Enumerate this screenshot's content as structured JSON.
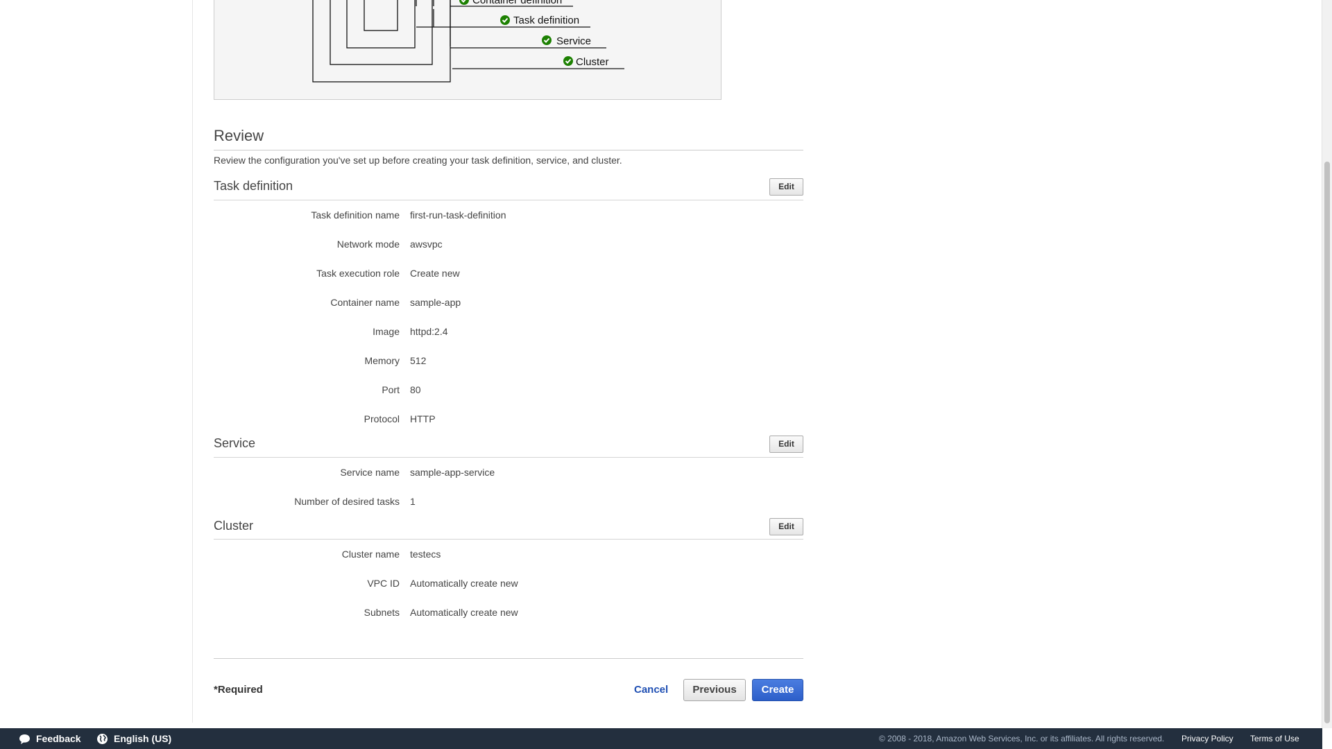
{
  "diagram": {
    "labels": [
      "Container definition",
      "Task definition",
      "Service",
      "Cluster"
    ],
    "check_color": "#1d8102"
  },
  "review": {
    "title": "Review",
    "description": "Review the configuration you've set up before creating your task definition, service, and cluster."
  },
  "sections": {
    "task_definition": {
      "title": "Task definition",
      "edit_label": "Edit",
      "rows": [
        {
          "label": "Task definition name",
          "value": "first-run-task-definition"
        },
        {
          "label": "Network mode",
          "value": "awsvpc"
        },
        {
          "label": "Task execution role",
          "value": "Create new"
        },
        {
          "label": "Container name",
          "value": "sample-app"
        },
        {
          "label": "Image",
          "value": "httpd:2.4"
        },
        {
          "label": "Memory",
          "value": "512"
        },
        {
          "label": "Port",
          "value": "80"
        },
        {
          "label": "Protocol",
          "value": "HTTP"
        }
      ]
    },
    "service": {
      "title": "Service",
      "edit_label": "Edit",
      "rows": [
        {
          "label": "Service name",
          "value": "sample-app-service"
        },
        {
          "label": "Number of desired tasks",
          "value": "1"
        }
      ]
    },
    "cluster": {
      "title": "Cluster",
      "edit_label": "Edit",
      "rows": [
        {
          "label": "Cluster name",
          "value": "testecs"
        },
        {
          "label": "VPC ID",
          "value": "Automatically create new"
        },
        {
          "label": "Subnets",
          "value": "Automatically create new"
        }
      ]
    }
  },
  "actions": {
    "required_note": "*Required",
    "cancel_label": "Cancel",
    "previous_label": "Previous",
    "create_label": "Create",
    "primary_color": "#2d5fc9"
  },
  "footer": {
    "feedback_label": "Feedback",
    "language_label": "English (US)",
    "copyright": "© 2008 - 2018, Amazon Web Services, Inc. or its affiliates. All rights reserved.",
    "privacy_label": "Privacy Policy",
    "terms_label": "Terms of Use",
    "background": "#232f3e"
  }
}
